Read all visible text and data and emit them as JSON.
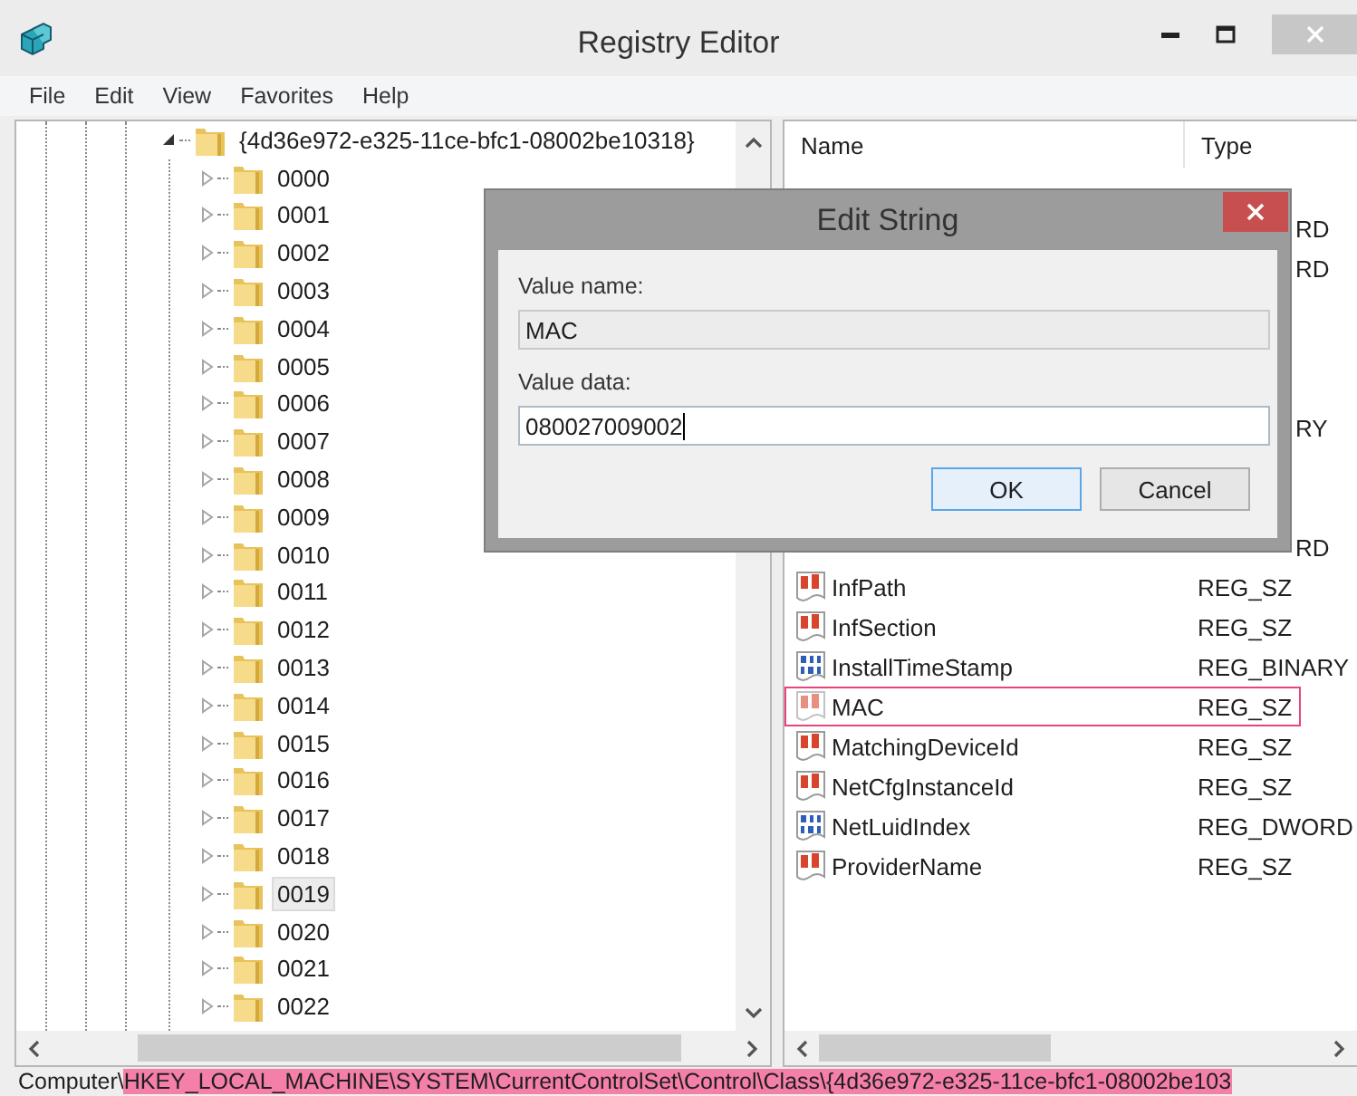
{
  "window": {
    "title": "Registry Editor"
  },
  "menu": [
    "File",
    "Edit",
    "View",
    "Favorites",
    "Help"
  ],
  "tree": {
    "label": "{4d36e972-e325-11ce-bfc1-08002be10318}",
    "expanded": true,
    "selected": false,
    "children": [
      {
        "label": "0000",
        "expanded": false,
        "selected": false
      },
      {
        "label": "0001",
        "expanded": false,
        "selected": false
      },
      {
        "label": "0002",
        "expanded": false,
        "selected": false
      },
      {
        "label": "0003",
        "expanded": false,
        "selected": false
      },
      {
        "label": "0004",
        "expanded": false,
        "selected": false
      },
      {
        "label": "0005",
        "expanded": false,
        "selected": false
      },
      {
        "label": "0006",
        "expanded": false,
        "selected": false
      },
      {
        "label": "0007",
        "expanded": false,
        "selected": false
      },
      {
        "label": "0008",
        "expanded": false,
        "selected": false
      },
      {
        "label": "0009",
        "expanded": false,
        "selected": false
      },
      {
        "label": "0010",
        "expanded": false,
        "selected": false
      },
      {
        "label": "0011",
        "expanded": false,
        "selected": false
      },
      {
        "label": "0012",
        "expanded": false,
        "selected": false
      },
      {
        "label": "0013",
        "expanded": false,
        "selected": false
      },
      {
        "label": "0014",
        "expanded": false,
        "selected": false
      },
      {
        "label": "0015",
        "expanded": false,
        "selected": false
      },
      {
        "label": "0016",
        "expanded": false,
        "selected": false
      },
      {
        "label": "0017",
        "expanded": false,
        "selected": false
      },
      {
        "label": "0018",
        "expanded": false,
        "selected": false
      },
      {
        "label": "0019",
        "expanded": false,
        "selected": true
      },
      {
        "label": "0020",
        "expanded": false,
        "selected": false
      },
      {
        "label": "0021",
        "expanded": false,
        "selected": false
      },
      {
        "label": "0022",
        "expanded": false,
        "selected": false
      }
    ]
  },
  "list": {
    "columns": [
      "Name",
      "Type"
    ],
    "rows": [
      {
        "kind": "covered"
      },
      {
        "kind": "covered",
        "type": "RD"
      },
      {
        "kind": "covered",
        "type": "RD"
      },
      {
        "kind": "covered"
      },
      {
        "kind": "covered"
      },
      {
        "kind": "covered"
      },
      {
        "kind": "covered",
        "type": "RY"
      },
      {
        "kind": "covered"
      },
      {
        "kind": "covered"
      },
      {
        "kind": "covered",
        "type": "RD"
      },
      {
        "kind": "string",
        "name": "InfPath",
        "type": "REG_SZ",
        "selected": false,
        "highlighted": false
      },
      {
        "kind": "string",
        "name": "InfSection",
        "type": "REG_SZ",
        "selected": false,
        "highlighted": false
      },
      {
        "kind": "binary",
        "name": "InstallTimeStamp",
        "type": "REG_BINARY",
        "selected": false,
        "highlighted": false
      },
      {
        "kind": "string",
        "name": "MAC",
        "type": "REG_SZ",
        "selected": true,
        "highlighted": true
      },
      {
        "kind": "string",
        "name": "MatchingDeviceId",
        "type": "REG_SZ",
        "selected": false,
        "highlighted": false
      },
      {
        "kind": "string",
        "name": "NetCfgInstanceId",
        "type": "REG_SZ",
        "selected": false,
        "highlighted": false
      },
      {
        "kind": "binary",
        "name": "NetLuidIndex",
        "type": "REG_DWORD",
        "selected": false,
        "highlighted": false
      },
      {
        "kind": "string",
        "name": "ProviderName",
        "type": "REG_SZ",
        "selected": false,
        "highlighted": false
      }
    ]
  },
  "dialog": {
    "title": "Edit String",
    "name_label": "Value name:",
    "name_value": "MAC",
    "data_label": "Value data:",
    "data_value": "080027009002",
    "buttons": [
      {
        "label": "OK",
        "default": true
      },
      {
        "label": "Cancel",
        "default": false
      }
    ]
  },
  "status_bar": {
    "prefix": "Computer\\",
    "path": "HKEY_LOCAL_MACHINE\\SYSTEM\\CurrentControlSet\\Control\\Class\\{4d36e972-e325-11ce-bfc1-08002be103",
    "path_highlighted": true
  }
}
